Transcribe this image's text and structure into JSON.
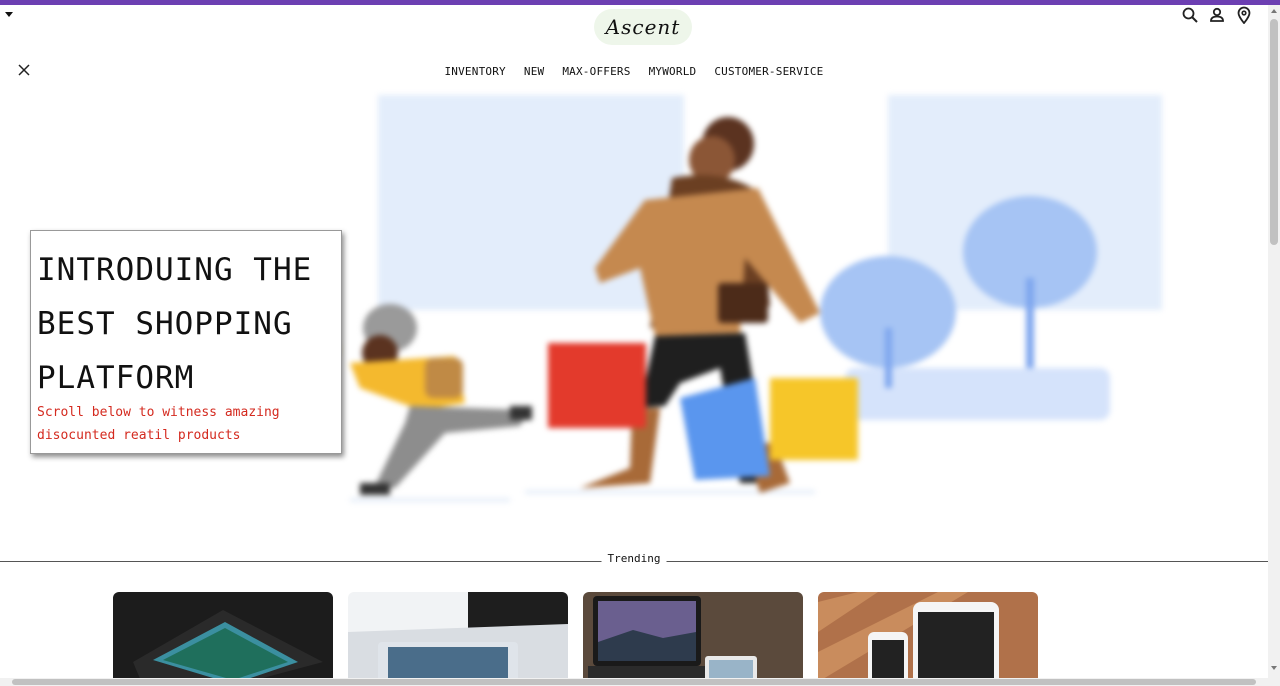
{
  "header": {
    "logo_text": "Ascent",
    "icons": [
      "search-icon",
      "user-icon",
      "location-pin-icon"
    ],
    "brand_color": "#6c3fb2"
  },
  "nav": {
    "items": [
      "INVENTORY",
      "NEW",
      "MAX-OFFERS",
      "MYWORLD",
      "CUSTOMER-SERVICE"
    ]
  },
  "hero": {
    "title": "INTRODUING THE\nBEST SHOPPING\nPLATFORM",
    "subtitle": "Scroll below to witness amazing disocunted reatil products",
    "subtitle_color": "#d42a1f"
  },
  "trending": {
    "label": "Trending",
    "cards": [
      "tablet-on-desk",
      "laptop-and-tablet",
      "macbook-and-devices",
      "phone-and-tablet-on-wood"
    ]
  }
}
